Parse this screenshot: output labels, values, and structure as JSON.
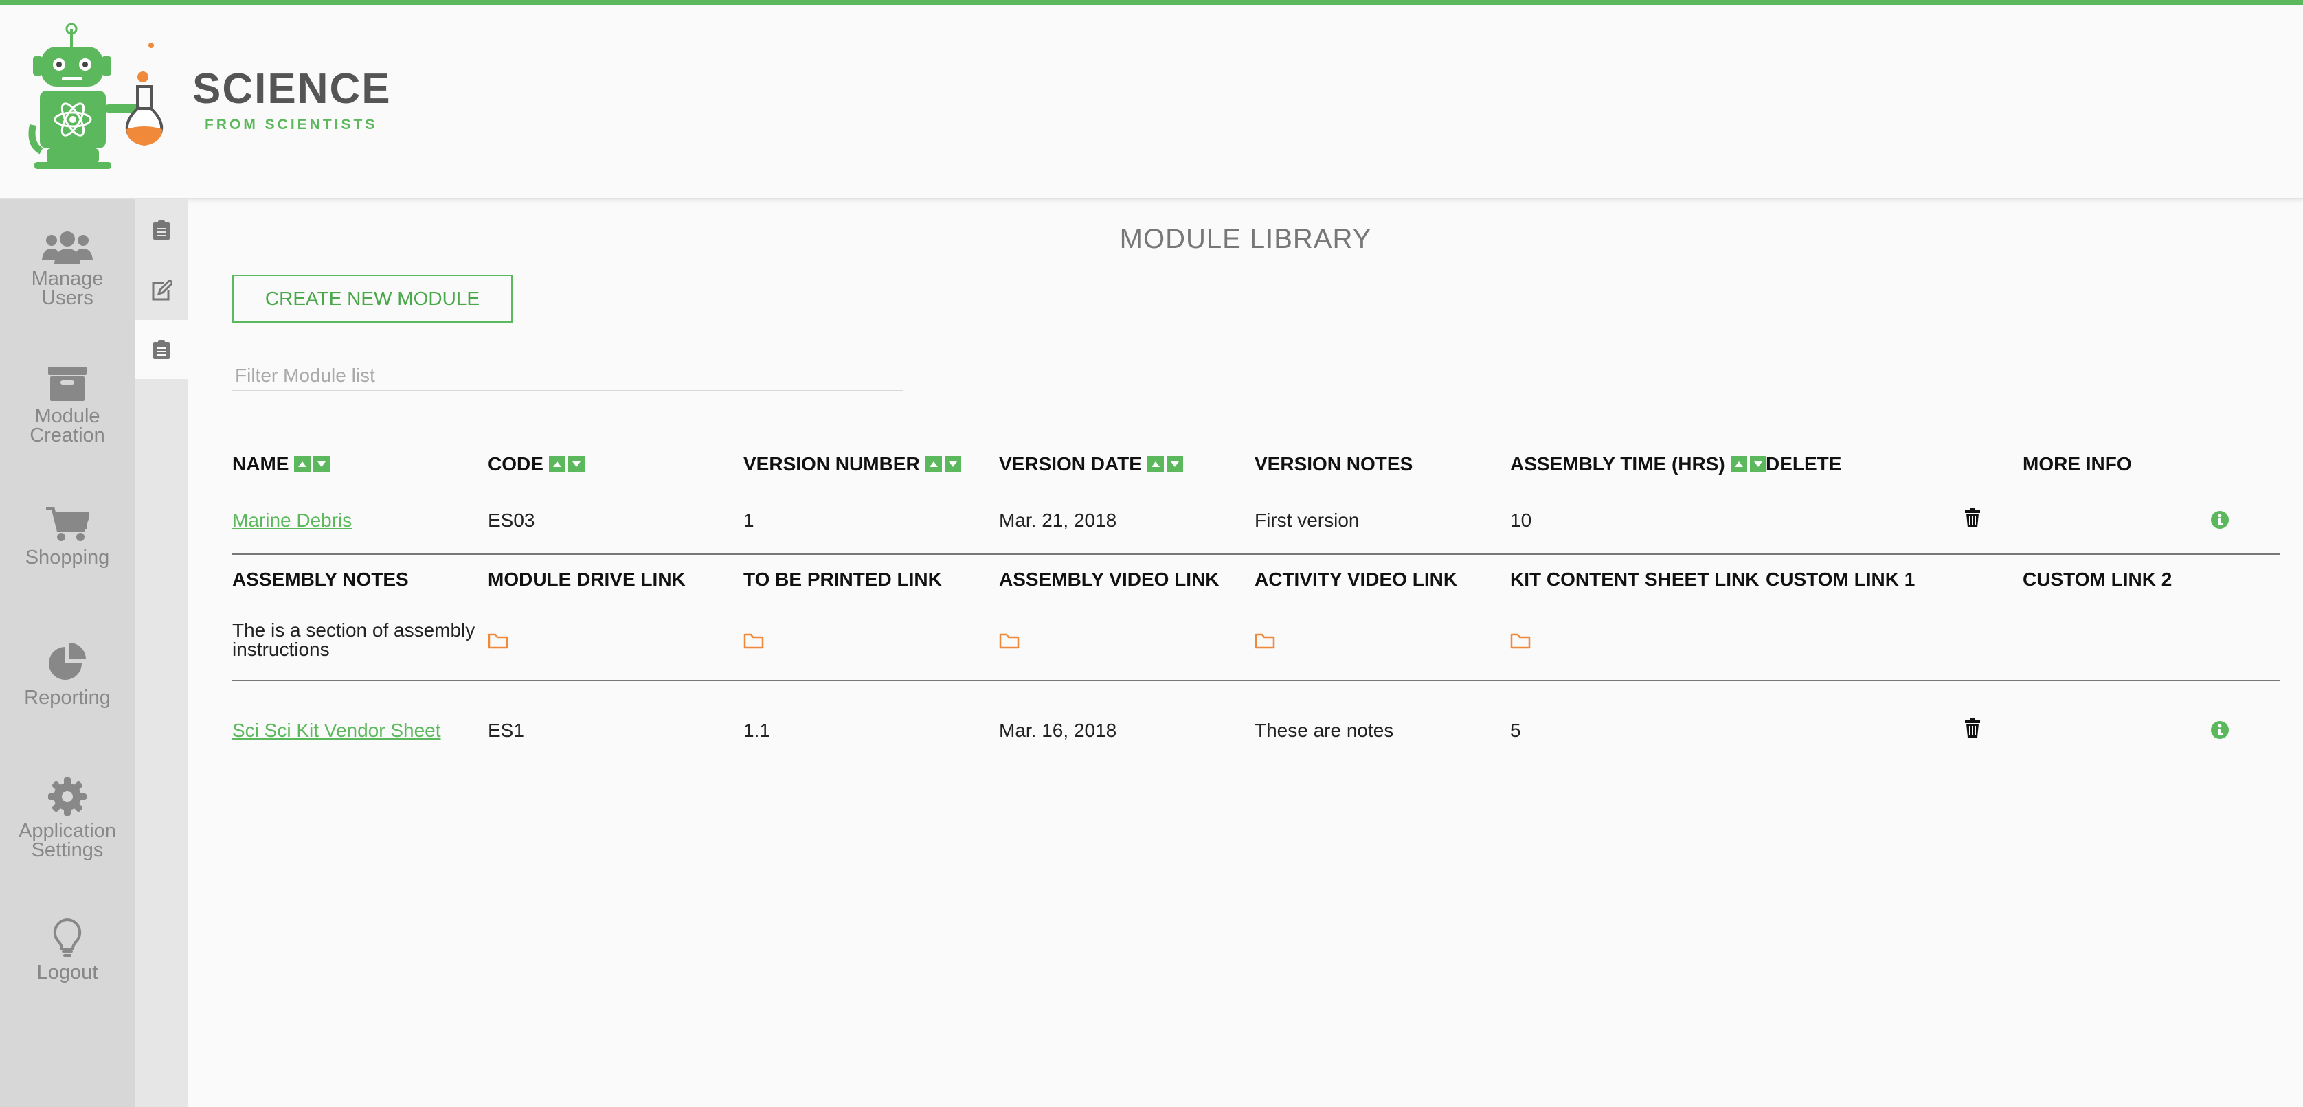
{
  "brand": {
    "name": "SCIENCE",
    "tagline": "FROM SCIENTISTS",
    "accent": "#5cb85c",
    "orange": "#f08a3a"
  },
  "sidebar": {
    "items": [
      {
        "label_line1": "Manage",
        "label_line2": "Users",
        "icon": "users-icon"
      },
      {
        "label_line1": "Module",
        "label_line2": "Creation",
        "icon": "archive-box-icon"
      },
      {
        "label_line1": "Shopping",
        "label_line2": "",
        "icon": "cart-icon"
      },
      {
        "label_line1": "Reporting",
        "label_line2": "",
        "icon": "pie-chart-icon"
      },
      {
        "label_line1": "Application",
        "label_line2": "Settings",
        "icon": "gear-icon"
      },
      {
        "label_line1": "Logout",
        "label_line2": "",
        "icon": "lightbulb-icon"
      }
    ]
  },
  "subbar": {
    "items": [
      {
        "icon": "clipboard-icon"
      },
      {
        "icon": "edit-icon"
      },
      {
        "icon": "clipboard-icon",
        "active": true
      }
    ]
  },
  "page": {
    "title": "MODULE LIBRARY",
    "create_button": "CREATE NEW MODULE",
    "filter_placeholder": "Filter Module list"
  },
  "table": {
    "headers": {
      "name": "NAME",
      "code": "CODE",
      "version_number": "VERSION NUMBER",
      "version_date": "VERSION DATE",
      "version_notes": "VERSION NOTES",
      "assembly_time": "ASSEMBLY TIME (HRS)",
      "delete": "DELETE",
      "more_info": "MORE INFO"
    },
    "detail_headers": {
      "assembly_notes": "ASSEMBLY NOTES",
      "module_drive_link": "MODULE DRIVE LINK",
      "to_be_printed_link": "TO BE PRINTED LINK",
      "assembly_video_link": "ASSEMBLY VIDEO LINK",
      "activity_video_link": "ACTIVITY VIDEO LINK",
      "kit_content_sheet_link": "KIT CONTENT SHEET LINK",
      "custom_link_1": "CUSTOM LINK 1",
      "custom_link_2": "CUSTOM LINK 2"
    },
    "rows": [
      {
        "name": "Marine Debris",
        "code": "ES03",
        "version_number": "1",
        "version_date": "Mar. 21, 2018",
        "version_notes": "First version",
        "assembly_time": "10",
        "assembly_notes_line1": "The is a section of assembly",
        "assembly_notes_line2": "instructions"
      },
      {
        "name": "Sci Sci Kit Vendor Sheet",
        "code": "ES1",
        "version_number": "1.1",
        "version_date": "Mar. 16, 2018",
        "version_notes": "These are notes",
        "assembly_time": "5"
      }
    ]
  }
}
